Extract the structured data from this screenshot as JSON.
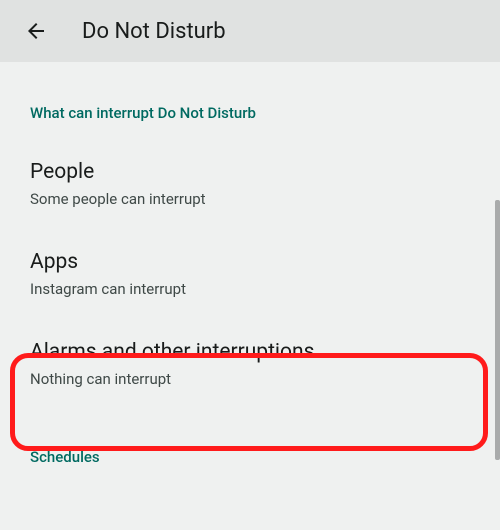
{
  "header": {
    "title": "Do Not Disturb"
  },
  "sections": {
    "interrupt_header": "What can interrupt Do Not Disturb",
    "schedules_header": "Schedules"
  },
  "items": {
    "people": {
      "title": "People",
      "subtitle": "Some people can interrupt"
    },
    "apps": {
      "title": "Apps",
      "subtitle": "Instagram can interrupt"
    },
    "alarms": {
      "title": "Alarms and other interruptions",
      "subtitle": "Nothing can interrupt"
    }
  }
}
